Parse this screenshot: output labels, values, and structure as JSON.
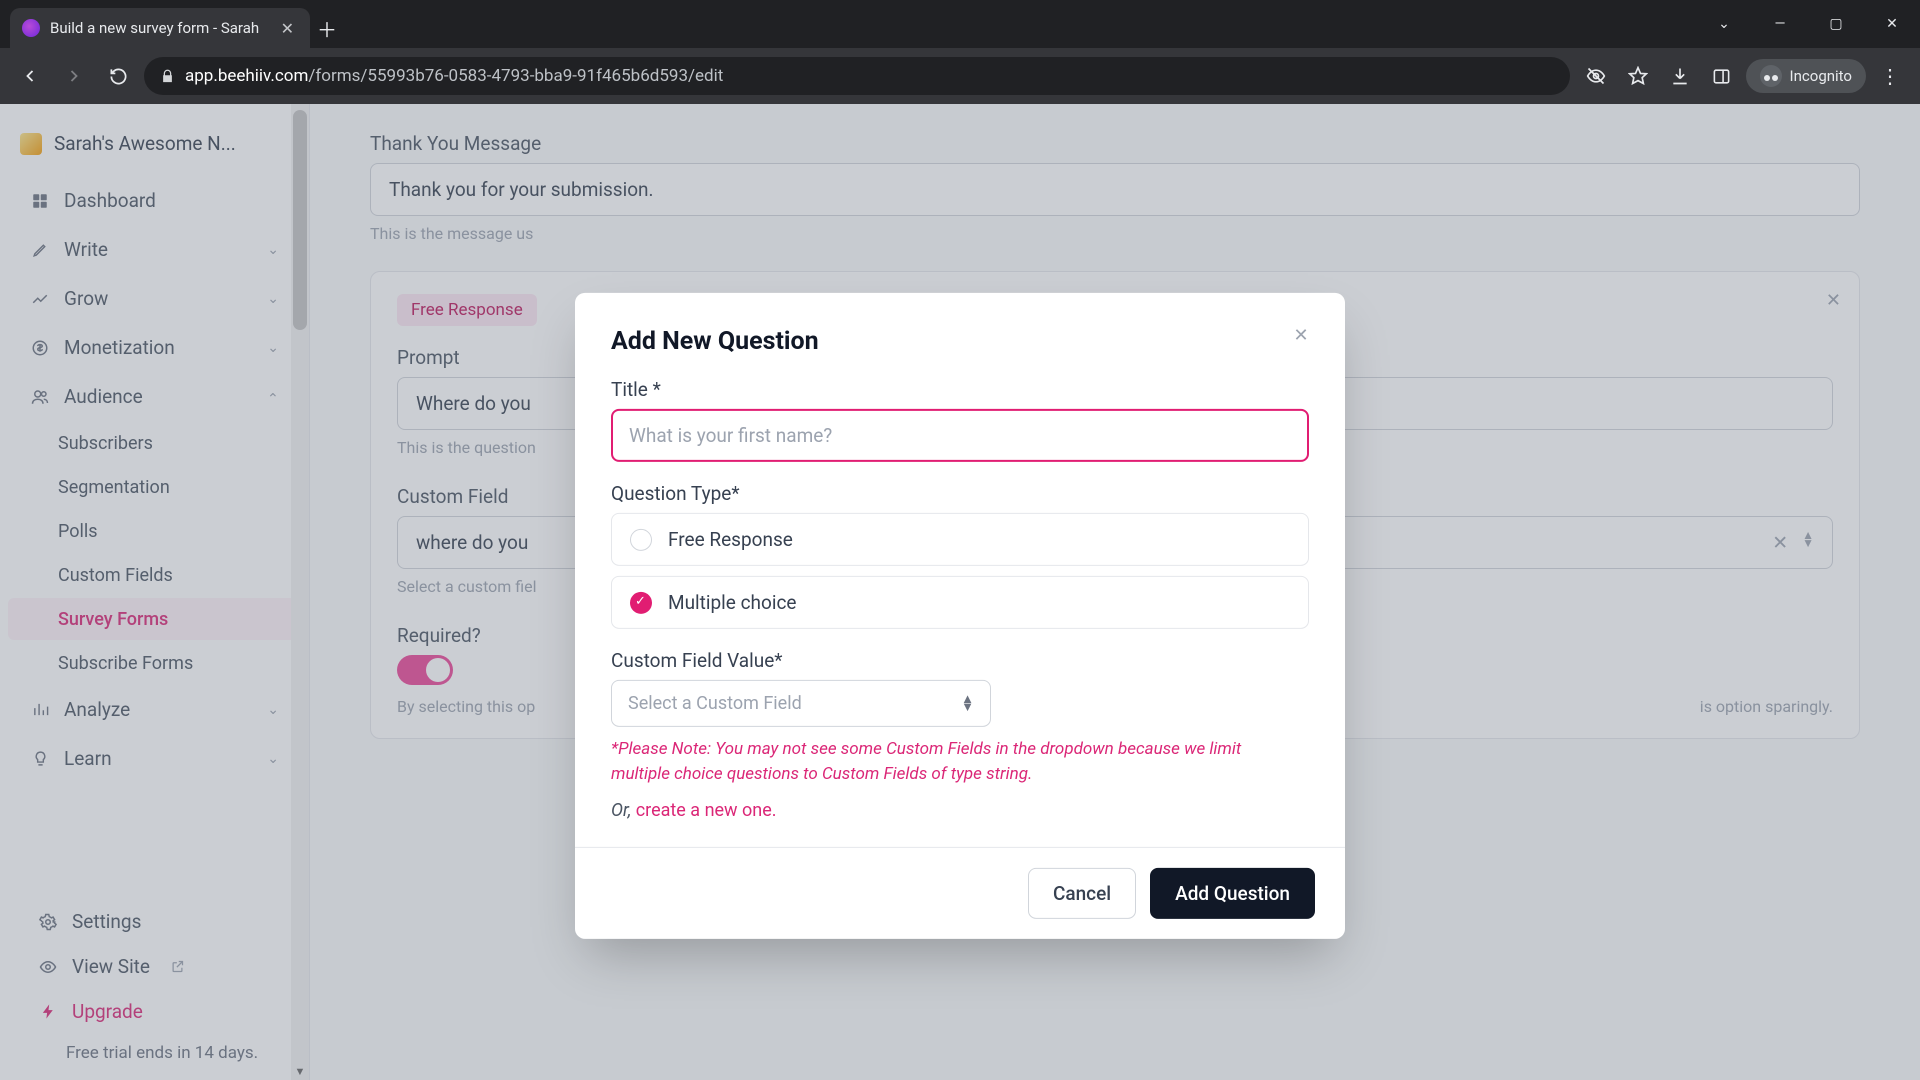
{
  "browser": {
    "tab_title": "Build a new survey form - Sarah",
    "url_host": "app.beehiiv.com",
    "url_path": "/forms/55993b76-0583-4793-bba9-91f465b6d593/edit",
    "incognito_label": "Incognito"
  },
  "sidebar": {
    "workspace": "Sarah's Awesome N...",
    "items": {
      "dashboard": "Dashboard",
      "write": "Write",
      "grow": "Grow",
      "monetization": "Monetization",
      "audience": "Audience",
      "analyze": "Analyze",
      "learn": "Learn"
    },
    "audience_sub": {
      "subscribers": "Subscribers",
      "segmentation": "Segmentation",
      "polls": "Polls",
      "custom_fields": "Custom Fields",
      "survey_forms": "Survey Forms",
      "subscribe_forms": "Subscribe Forms"
    },
    "bottom": {
      "settings": "Settings",
      "view_site": "View Site",
      "upgrade": "Upgrade",
      "trial": "Free trial ends in 14 days."
    }
  },
  "main": {
    "thank_you_label": "Thank You Message",
    "thank_you_value": "Thank you for your submission.",
    "thank_you_hint": "This is the message us",
    "chip": "Free Response",
    "prompt_label": "Prompt",
    "prompt_value": "Where do you",
    "prompt_hint": "This is the question",
    "cf_label": "Custom Field",
    "cf_value": "where do you",
    "cf_hint": "Select a custom fiel",
    "required_label": "Required?",
    "required_hint_left": "By selecting this op",
    "required_hint_right": "is option sparingly."
  },
  "modal": {
    "title": "Add New Question",
    "title_label": "Title *",
    "title_placeholder": "What is your first name?",
    "qtype_label": "Question Type*",
    "opt_free": "Free Response",
    "opt_multi": "Multiple choice",
    "cfv_label": "Custom Field Value*",
    "cfv_placeholder": "Select a Custom Field",
    "note": "*Please Note: You may not see some Custom Fields in the dropdown because we limit multiple choice questions to Custom Fields of type string.",
    "or_prefix": "Or, ",
    "or_link": "create a new one.",
    "cancel": "Cancel",
    "submit": "Add Question"
  }
}
